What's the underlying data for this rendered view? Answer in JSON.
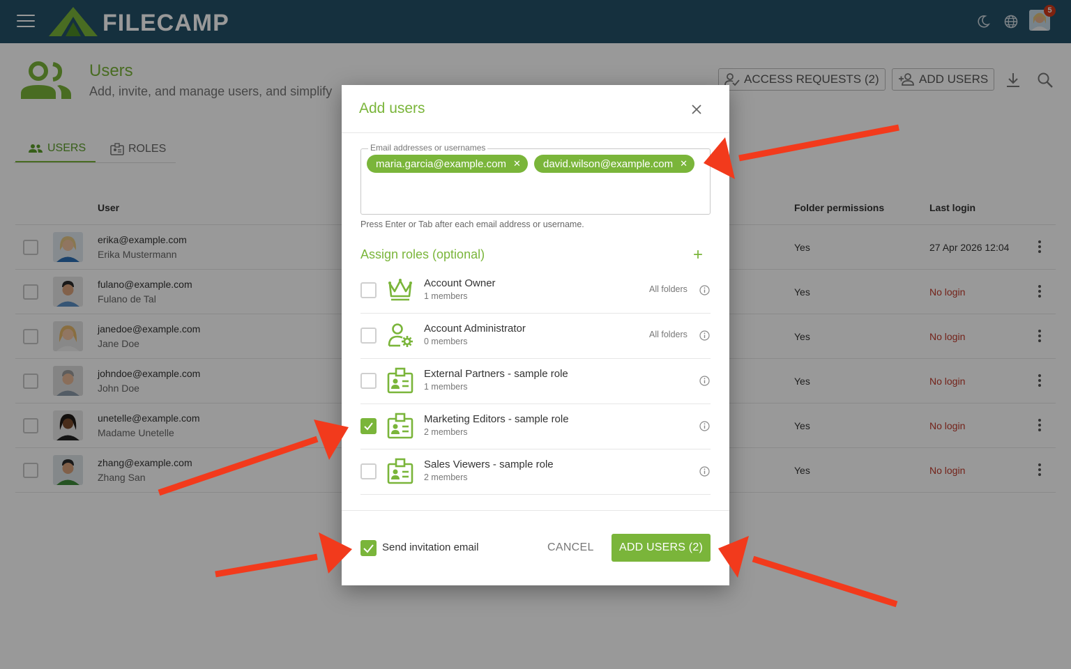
{
  "app": {
    "brand": "FILECAMP",
    "notification_count": "5"
  },
  "page": {
    "title": "Users",
    "subtitle": "Add, invite, and manage users, and simplify",
    "access_requests_label": "ACCESS REQUESTS (2)",
    "add_users_label": "ADD USERS"
  },
  "tabs": [
    {
      "label": "USERS",
      "active": true
    },
    {
      "label": "ROLES",
      "active": false
    }
  ],
  "table": {
    "headers": {
      "user": "User",
      "folder_permissions": "Folder permissions",
      "last_login": "Last login"
    },
    "rows": [
      {
        "email": "erika@example.com",
        "name": "Erika Mustermann",
        "folder_permissions": "Yes",
        "last_login": "27 Apr 2026 12:04"
      },
      {
        "email": "fulano@example.com",
        "name": "Fulano de Tal",
        "folder_permissions": "Yes",
        "last_login": "No login"
      },
      {
        "email": "janedoe@example.com",
        "name": "Jane Doe",
        "folder_permissions": "Yes",
        "last_login": "No login"
      },
      {
        "email": "johndoe@example.com",
        "name": "John Doe",
        "folder_permissions": "Yes",
        "last_login": "No login"
      },
      {
        "email": "unetelle@example.com",
        "name": "Madame Unetelle",
        "folder_permissions": "Yes",
        "last_login": "No login"
      },
      {
        "email": "zhang@example.com",
        "name": "Zhang San",
        "folder_permissions": "Yes",
        "last_login": "No login"
      }
    ]
  },
  "modal": {
    "title": "Add users",
    "emails_label": "Email addresses or usernames",
    "chips": [
      "maria.garcia@example.com",
      "david.wilson@example.com"
    ],
    "hint": "Press Enter or Tab after each email address or username.",
    "assign_title": "Assign roles (optional)",
    "roles": [
      {
        "name": "Account Owner",
        "members": "1 members",
        "scope": "All folders",
        "checked": false,
        "icon": "crown-icon"
      },
      {
        "name": "Account Administrator",
        "members": "0 members",
        "scope": "All folders",
        "checked": false,
        "icon": "user-gear-icon"
      },
      {
        "name": "External Partners - sample role",
        "members": "1 members",
        "scope": "",
        "checked": false,
        "icon": "id-badge-icon"
      },
      {
        "name": "Marketing Editors - sample role",
        "members": "2 members",
        "scope": "",
        "checked": true,
        "icon": "id-badge-icon"
      },
      {
        "name": "Sales Viewers - sample role",
        "members": "2 members",
        "scope": "",
        "checked": false,
        "icon": "id-badge-icon"
      }
    ],
    "send_invitation_label": "Send invitation email",
    "send_invitation_checked": true,
    "cancel_label": "CANCEL",
    "submit_label": "ADD USERS (2)"
  },
  "colors": {
    "brand_green": "#7ab53a",
    "topbar": "#245068",
    "arrow": "#f23a1c",
    "no_login": "#c0392b"
  }
}
